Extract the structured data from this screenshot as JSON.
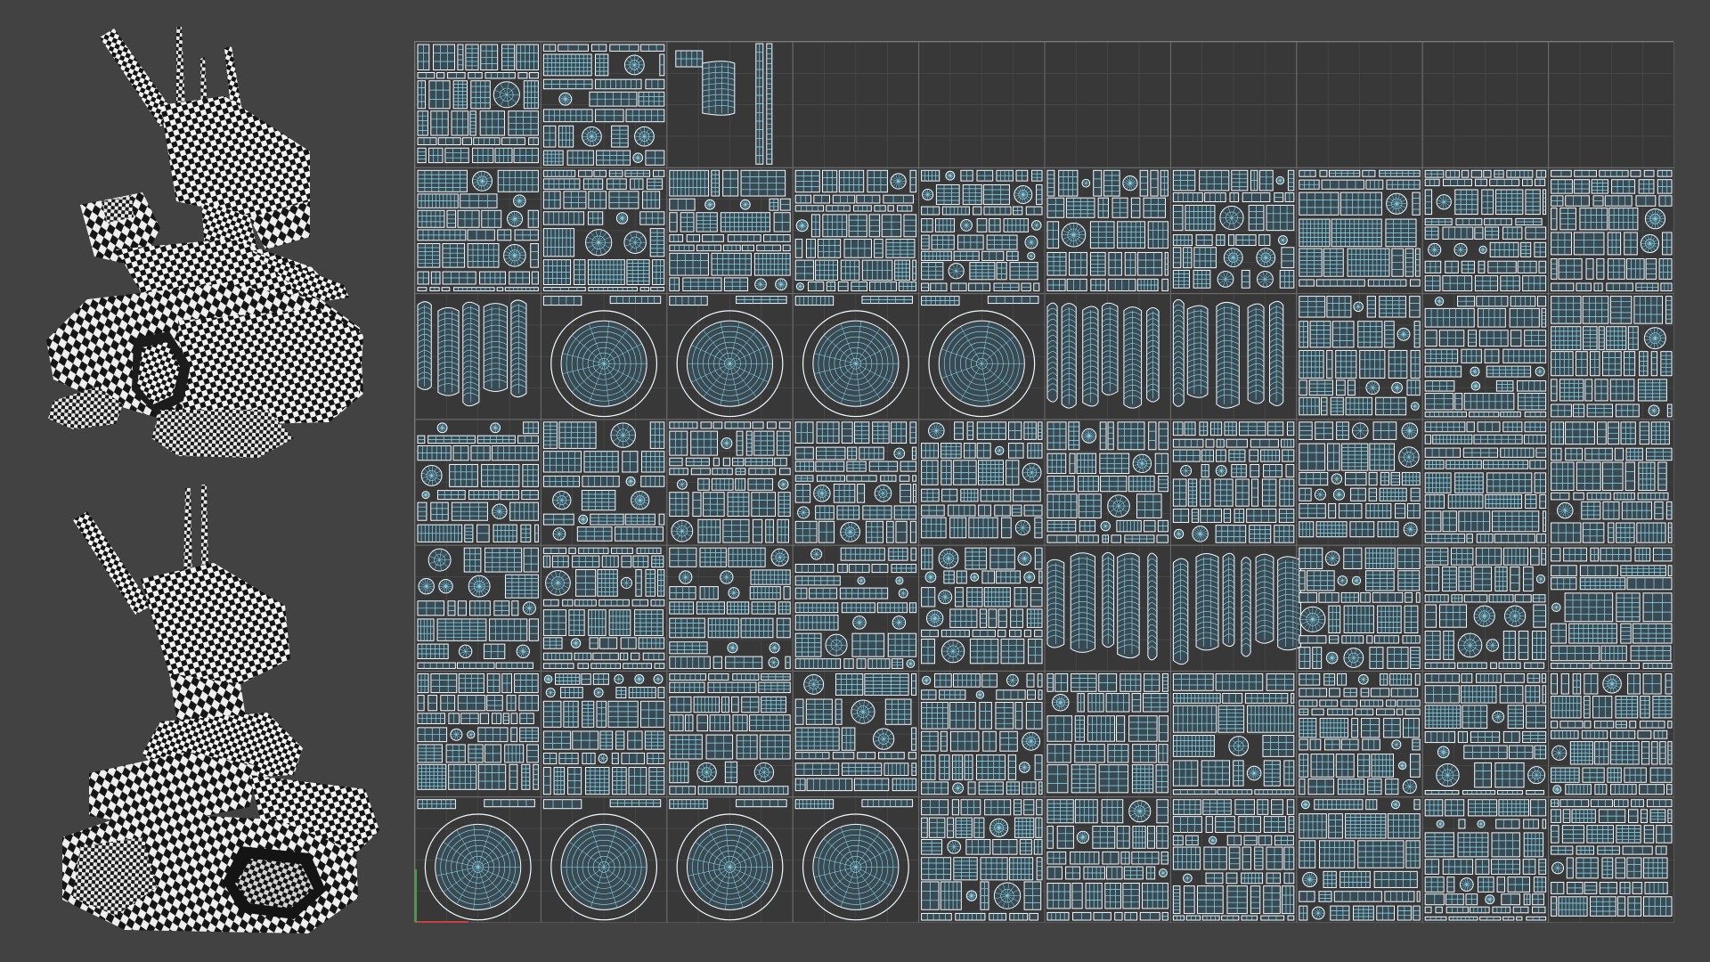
{
  "viewport": {
    "background_color": "#424242",
    "uv_background_color": "#383838",
    "uv_wire_color": "#8fdcf0",
    "uv_edge_color": "#f4fbff",
    "grid_color": "#4e4e4e",
    "checker_dark": "#141414",
    "checker_light": "#f2f2f2"
  },
  "renders": [
    {
      "view": "front-three-quarter",
      "material": "checker"
    },
    {
      "view": "rear-three-quarter",
      "material": "checker"
    }
  ],
  "uv_atlas": {
    "tile_columns": 10,
    "tile_rows": 7,
    "empty_tiles": [
      [
        0,
        3
      ],
      [
        0,
        4
      ],
      [
        0,
        5
      ],
      [
        0,
        6
      ],
      [
        0,
        7
      ],
      [
        0,
        8
      ],
      [
        0,
        9
      ]
    ],
    "partial_tiles": [
      [
        0,
        2
      ]
    ]
  }
}
